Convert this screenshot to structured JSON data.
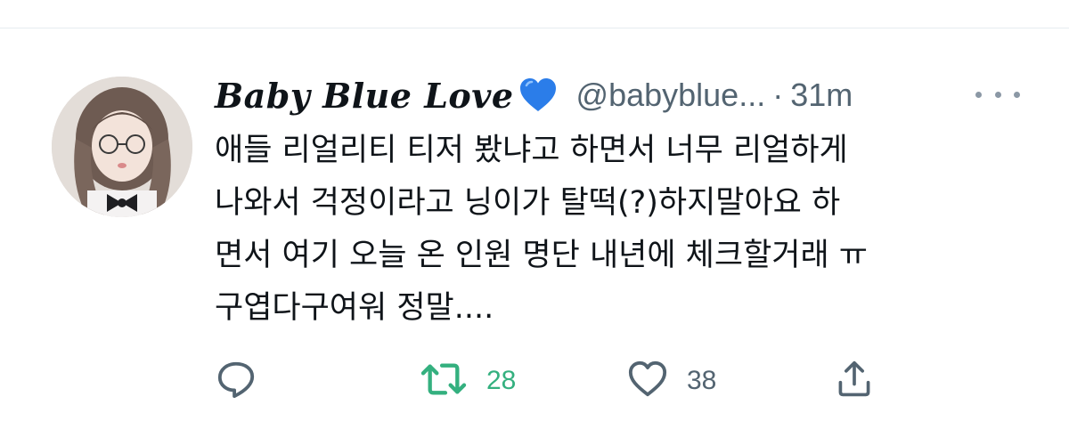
{
  "tweet": {
    "display_name": "Baby Blue Love",
    "name_emoji_icon": "blue-heart-icon",
    "handle": "@babyblue...",
    "separator": "·",
    "time": "31m",
    "more_icon": "more-dots-icon",
    "text_lines": [
      "애들 리얼리티 티저 봤냐고 하면서 너무 리얼하게",
      "나와서 걱정이라고 닝이가 탈떡(?)하지말아요 하",
      "면서 여기 오늘 온 인원 명단 내년에 체크할거래 ㅠ",
      "구엽다구여워 정말...."
    ]
  },
  "actions": {
    "reply": {
      "icon": "reply-icon"
    },
    "retweet": {
      "icon": "retweet-icon",
      "count": "28",
      "color": "#34b07f"
    },
    "like": {
      "icon": "heart-outline-icon",
      "count": "38"
    },
    "share": {
      "icon": "share-icon"
    }
  },
  "colors": {
    "text": "#0f1419",
    "secondary": "#536471",
    "retweet_active": "#34b07f",
    "heart_emoji": "#2b7de9"
  }
}
